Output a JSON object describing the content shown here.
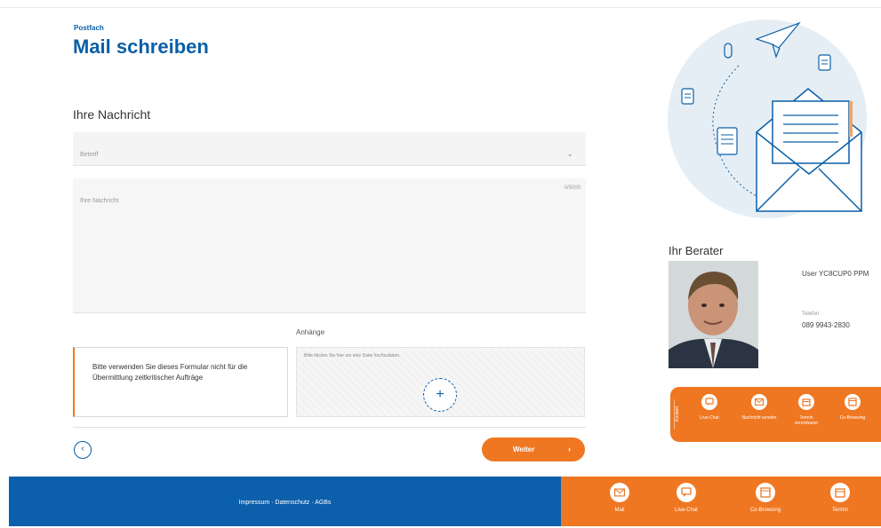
{
  "header": {
    "breadcrumb": "Postfach",
    "title": "Mail schreiben"
  },
  "form": {
    "section_title": "Ihre Nachricht",
    "subject_placeholder": "Betreff",
    "message_placeholder": "Ihre Nachricht",
    "char_counter": "0/5000",
    "attachments_label": "Anhänge",
    "upload_hint": "Bitte klicken Sie hier um eine Datei hochzuladen.",
    "notice_text": "Bitte verwenden Sie dieses Formular nicht für die Übermittlung zeitkritischer Aufträge",
    "next_button": "Weiter"
  },
  "advisor": {
    "title": "Ihr Berater",
    "name": "User YC8CUP0 PPM",
    "phone_label": "Telefon",
    "phone": "089 9943-2830"
  },
  "contact_bar": {
    "side_label": "Kontakt",
    "items": [
      {
        "label": "Live-Chat",
        "icon": "chat-icon"
      },
      {
        "label": "Nachricht senden",
        "icon": "mail-icon"
      },
      {
        "label": "Termin vereinbaren",
        "icon": "calendar-icon"
      },
      {
        "label": "Co-Browsing",
        "icon": "screen-icon"
      }
    ]
  },
  "footer": {
    "links": "Impressum · Datenschutz · AGBs",
    "items": [
      {
        "label": "Mail",
        "icon": "mail-icon"
      },
      {
        "label": "Live-Chat",
        "icon": "chat-icon"
      },
      {
        "label": "Co-Browsing",
        "icon": "screen-icon"
      },
      {
        "label": "Termin",
        "icon": "calendar-icon"
      }
    ]
  },
  "colors": {
    "primary_blue": "#0a5fa8",
    "accent_orange": "#ef7722",
    "footer_blue": "#0b5fab"
  }
}
